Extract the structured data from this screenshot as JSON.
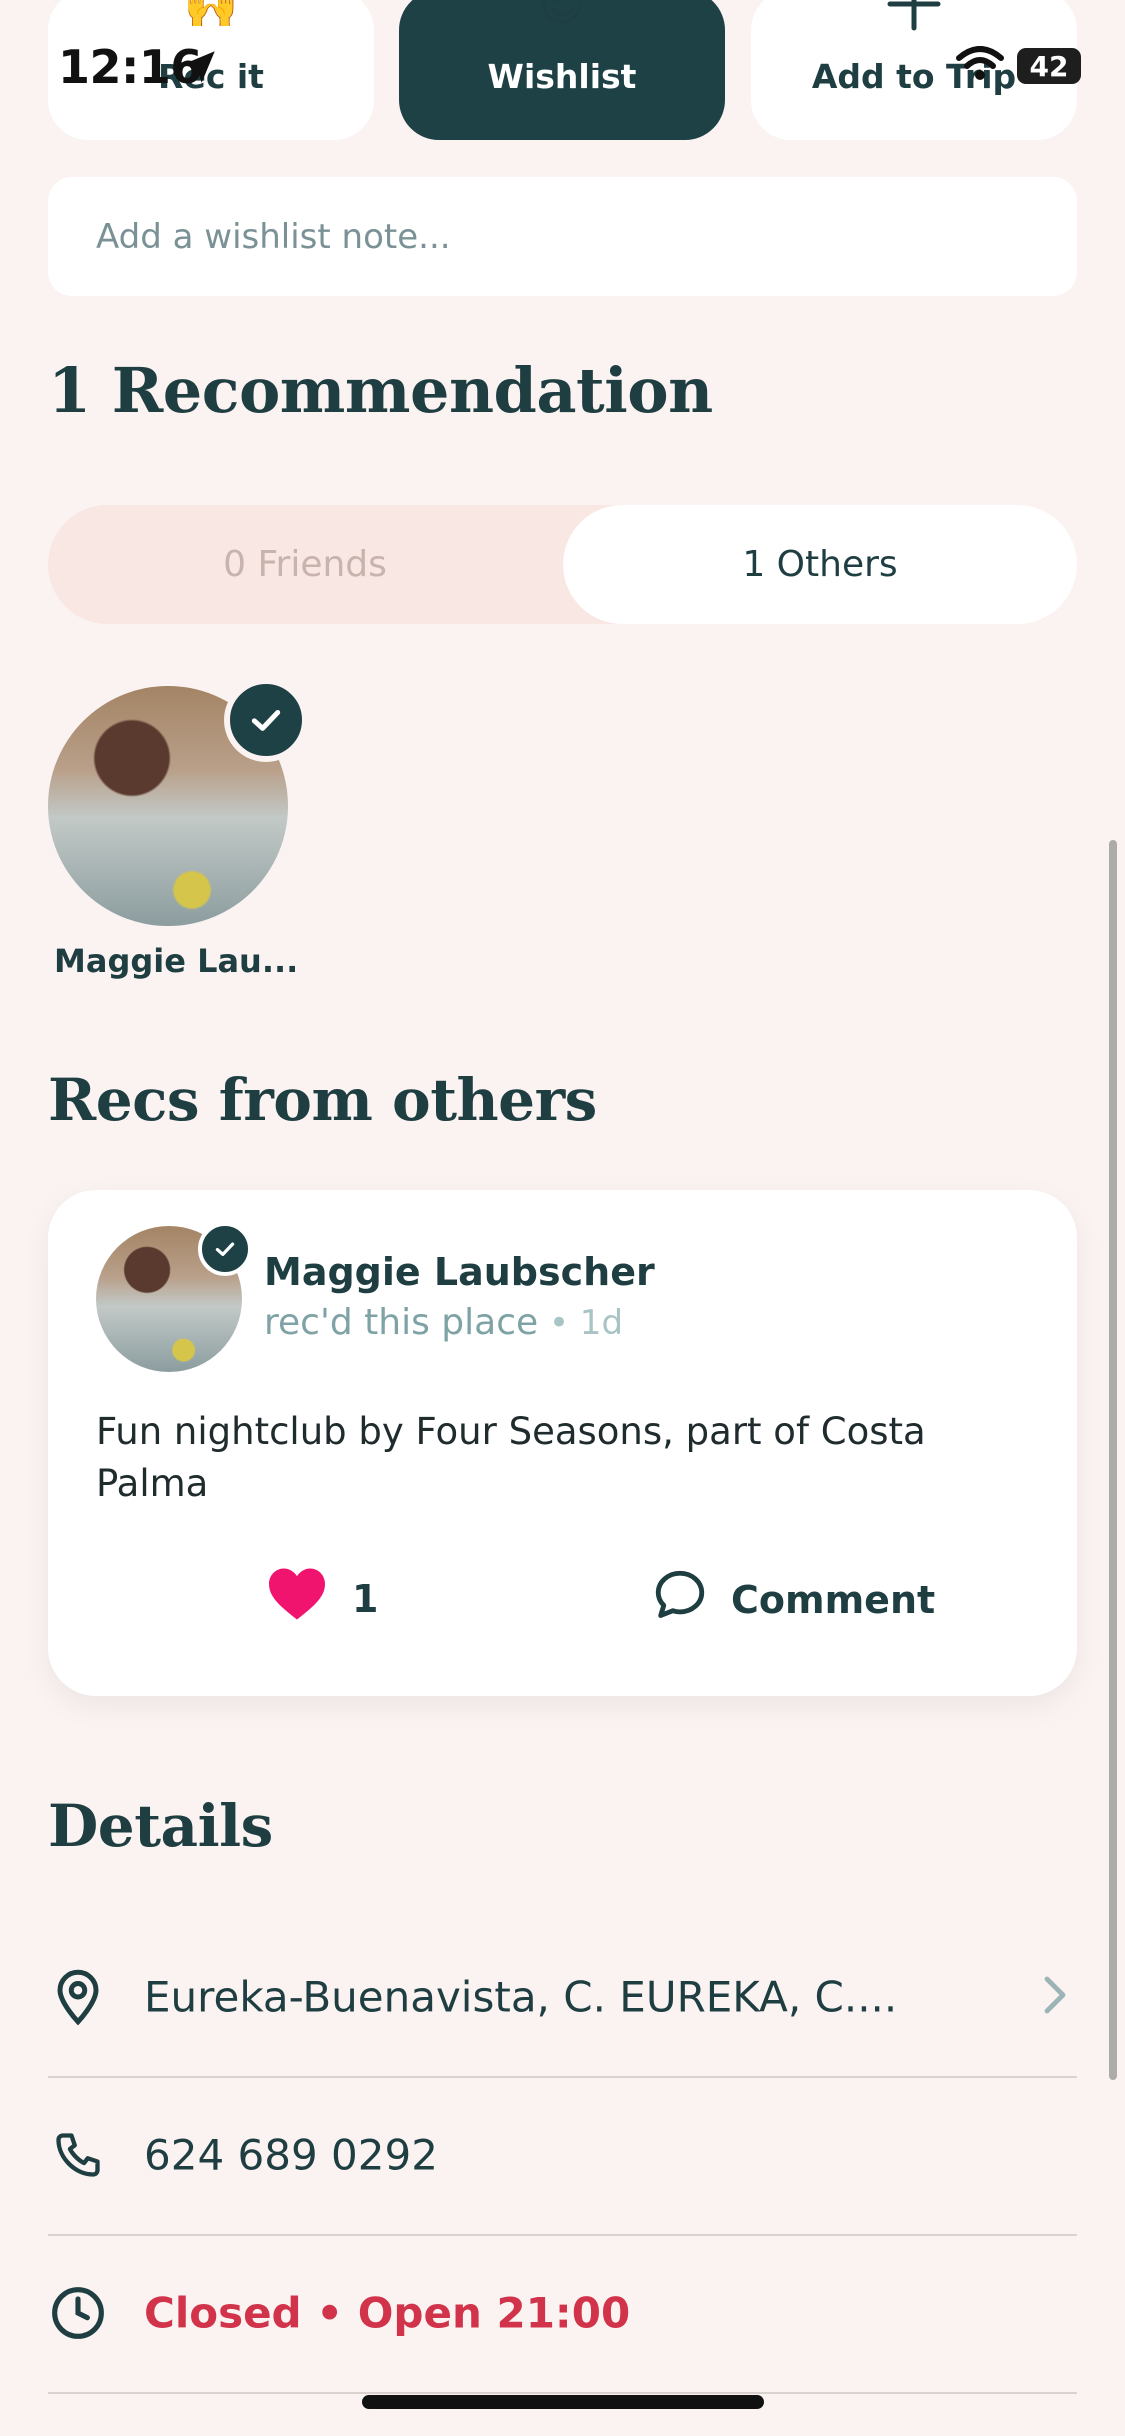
{
  "status_bar": {
    "time": "12:16",
    "battery": "42"
  },
  "actions": [
    {
      "label": "Rec it",
      "emoji": "🙌"
    },
    {
      "label": "Wishlist",
      "emoji": "😍"
    },
    {
      "label": "Add to Trip",
      "icon": "plus-icon"
    }
  ],
  "note": {
    "placeholder": "Add a wishlist note..."
  },
  "recommendations": {
    "heading": "1 Recommendation",
    "tabs": {
      "friends": "0 Friends",
      "others": "1 Others"
    },
    "recommender": {
      "short_name": "Maggie Lau..."
    }
  },
  "recs_from_others": {
    "heading": "Recs from others",
    "card": {
      "author": "Maggie Laubscher",
      "action": "rec'd this place",
      "ago": " • 1d",
      "text": "Fun nightclub by Four Seasons, part of Costa Palma",
      "likes": "1",
      "comment_label": "Comment"
    }
  },
  "details": {
    "heading": "Details",
    "address": "Eureka-Buenavista, C. EUREKA, C....",
    "phone": "624 689 0292",
    "hours": "Closed • Open 21:00"
  },
  "colors": {
    "background": "#FBF3F1",
    "primary_dark": "#1E4146",
    "heart": "#F0146E",
    "closed_red": "#D1334B"
  }
}
